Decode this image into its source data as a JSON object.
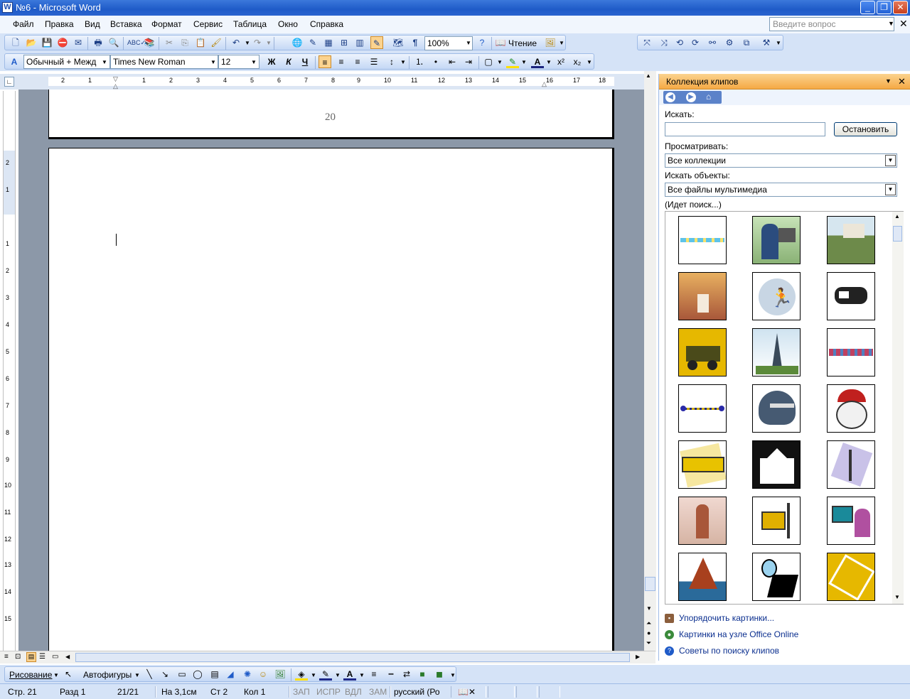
{
  "window": {
    "title": "№6 - Microsoft Word"
  },
  "menu": {
    "items": [
      "Файл",
      "Правка",
      "Вид",
      "Вставка",
      "Формат",
      "Сервис",
      "Таблица",
      "Окно",
      "Справка"
    ],
    "ask_placeholder": "Введите вопрос"
  },
  "standard_toolbar": {
    "zoom": "100%",
    "reading_label": "Чтение"
  },
  "formatting_toolbar": {
    "style": "Обычный + Межд",
    "font": "Times New Roman",
    "size": "12",
    "bold": "Ж",
    "italic": "К",
    "underline": "Ч",
    "pilcrow": "¶"
  },
  "ruler": {
    "numbers": [
      "2",
      "1",
      "1",
      "2",
      "3",
      "4",
      "5",
      "6",
      "7",
      "8",
      "9",
      "10",
      "11",
      "12",
      "13",
      "14",
      "15",
      "16",
      "17",
      "18"
    ]
  },
  "vruler": {
    "numbers": [
      "2",
      "1",
      "1",
      "2",
      "3",
      "4",
      "5",
      "6",
      "7",
      "8",
      "9",
      "10",
      "11",
      "12",
      "13",
      "14",
      "15"
    ]
  },
  "document": {
    "page_number": "20"
  },
  "task_pane": {
    "title": "Коллекция клипов",
    "search_label": "Искать:",
    "search_value": "",
    "stop_button": "Остановить",
    "browse_label": "Просматривать:",
    "browse_value": "Все коллекции",
    "objects_label": "Искать объекты:",
    "objects_value": "Все файлы мультимедиа",
    "status": "(Идет поиск...)",
    "links": [
      "Упорядочить картинки...",
      "Картинки на узле Office Online",
      "Советы по поиску клипов"
    ]
  },
  "drawing_toolbar": {
    "drawing": "Рисование",
    "autoshapes": "Автофигуры"
  },
  "status_bar": {
    "page": "Стр. 21",
    "section": "Разд 1",
    "pages": "21/21",
    "at": "На 3,1см",
    "line": "Ст 2",
    "col": "Кол 1",
    "rec": "ЗАП",
    "trk": "ИСПР",
    "ext": "ВДЛ",
    "ovr": "ЗАМ",
    "lang": "русский (Ро"
  }
}
